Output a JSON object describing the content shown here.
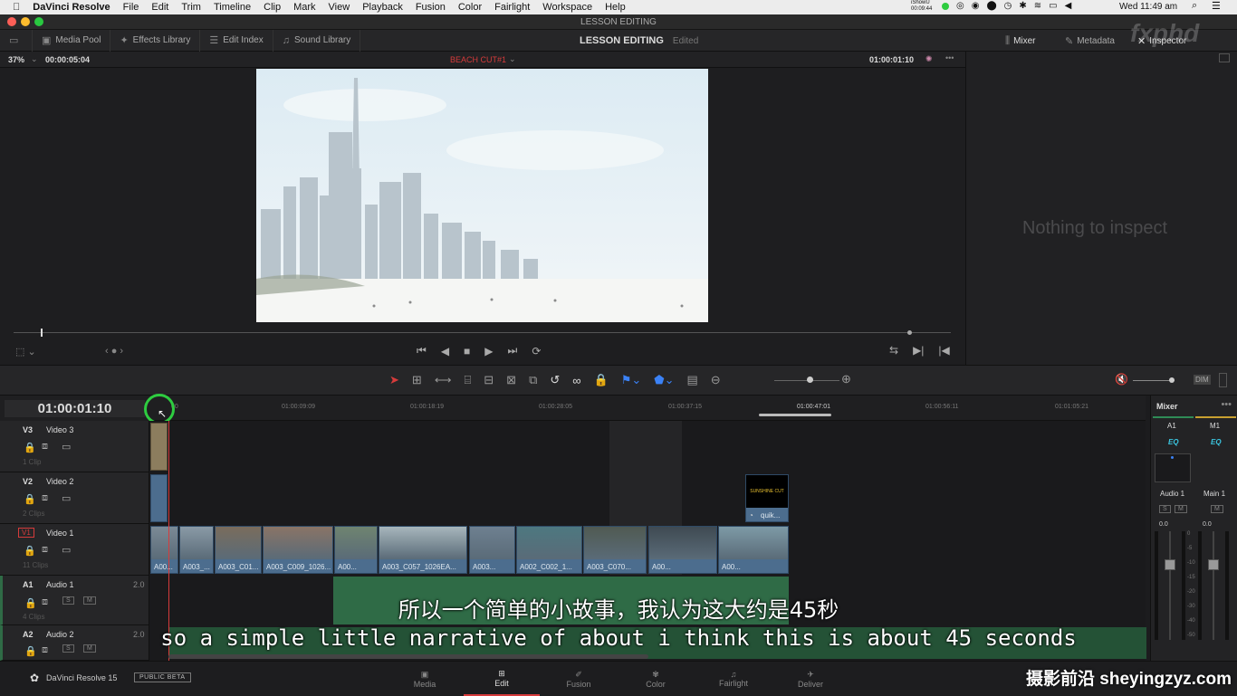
{
  "mac": {
    "app_name": "DaVinci Resolve",
    "menus": [
      "File",
      "Edit",
      "Trim",
      "Timeline",
      "Clip",
      "Mark",
      "View",
      "Playback",
      "Fusion",
      "Color",
      "Fairlight",
      "Workspace",
      "Help"
    ],
    "clock": "Wed 11:49 am",
    "recorder": "iShowU",
    "recorder_time": "00:09:44"
  },
  "window": {
    "title": "LESSON EDITING"
  },
  "toolbar": {
    "media_pool": "Media Pool",
    "effects_library": "Effects Library",
    "edit_index": "Edit Index",
    "sound_library": "Sound Library",
    "project_title": "LESSON EDITING",
    "project_status": "Edited",
    "mixer": "Mixer",
    "metadata": "Metadata",
    "inspector": "Inspector",
    "watermark": "fxphd"
  },
  "viewer": {
    "zoom": "37%",
    "duration": "00:00:05:04",
    "timeline_name": "BEACH CUT#1",
    "timecode": "01:00:01:10"
  },
  "inspector": {
    "empty_message": "Nothing to inspect"
  },
  "timeline": {
    "timecode": "01:00:01:10",
    "ruler": [
      "01:00:00:00",
      "01:00:09:09",
      "01:00:18:19",
      "01:00:28:05",
      "01:00:37:15",
      "01:00:47:01",
      "01:00:56:11",
      "01:01:05:21"
    ],
    "ruler_first_visible": "00",
    "tracks": [
      {
        "id": "V3",
        "name": "Video 3",
        "count": "1 Clip"
      },
      {
        "id": "V2",
        "name": "Video 2",
        "count": "2 Clips"
      },
      {
        "id": "V1",
        "name": "Video 1",
        "count": "11 Clips"
      },
      {
        "id": "A1",
        "name": "Audio 1",
        "level": "2.0",
        "count": "4 Clips"
      },
      {
        "id": "A2",
        "name": "Audio 2",
        "level": "2.0"
      }
    ],
    "track_buttons": {
      "solo": "S",
      "mute": "M"
    },
    "v2_clip_label": "quik...",
    "v2_title_text": "SUNSHINE CUT",
    "v1_clips": [
      "A00...",
      "A003_...",
      "A003_C01...",
      "A003_C009_1026...",
      "A00...",
      "A003_C057_1026EA...",
      "A003...",
      "A002_C002_1...",
      "A003_C070...",
      "A00...",
      "A00..."
    ]
  },
  "mixer": {
    "title": "Mixer",
    "channels": [
      {
        "id": "A1",
        "eq": "EQ",
        "name": "Audio 1",
        "level": "0.0"
      },
      {
        "id": "M1",
        "eq": "EQ",
        "name": "Main 1",
        "level": "0.0"
      }
    ],
    "scale": [
      "0",
      "-5",
      "-10",
      "-15",
      "-20",
      "-30",
      "-40",
      "-50"
    ],
    "solo": "S",
    "mute": "M"
  },
  "bottom": {
    "product": "DaVinci Resolve 15",
    "badge": "PUBLIC BETA",
    "pages": [
      "Media",
      "Edit",
      "Fusion",
      "Color",
      "Fairlight",
      "Deliver"
    ],
    "active_page": "Edit"
  },
  "subtitles": {
    "cn": "所以一个简单的小故事，我认为这大约是45秒",
    "en": "so a simple little narrative of about i think this is about 45 seconds"
  },
  "site_watermark": "摄影前沿 sheyingzyz.com",
  "colors": {
    "accent": "#d63b3b",
    "clip_blue": "#4c6d8e",
    "audio_green": "#2f6b46",
    "highlight": "#2ecc40"
  }
}
